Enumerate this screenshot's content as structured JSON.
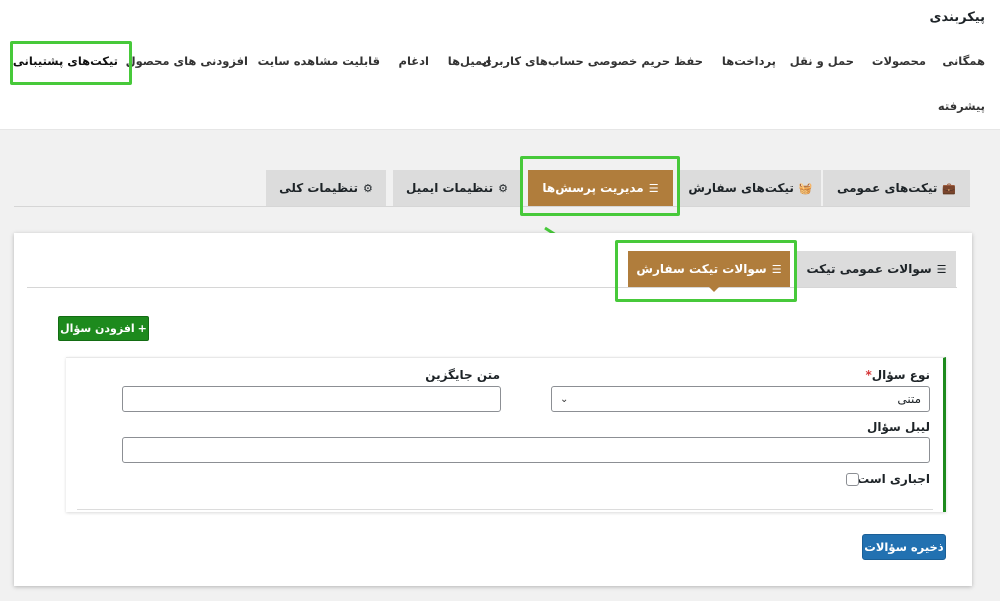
{
  "page": {
    "title": "پیکربندی"
  },
  "nav": {
    "items": [
      "همگانی",
      "محصولات",
      "حمل و نقل",
      "پرداخت‌ها",
      "حفظ حریم خصوصی حساب‌های کاربری",
      "ایمیل‌ها",
      "ادغام",
      "قابلیت مشاهده سایت",
      "افزودنی های محصول",
      "تیکت‌های پشتیبانی",
      "پیشرفته"
    ],
    "active": "تیکت‌های پشتیبانی"
  },
  "tabs": {
    "items": [
      {
        "label": "تیکت‌های عمومی",
        "icon": "briefcase-icon"
      },
      {
        "label": "تیکت‌های سفارش",
        "icon": "basket-icon"
      },
      {
        "label": "مدیریت پرسش‌ها",
        "icon": "list-icon"
      },
      {
        "label": "تنظیمات ایمیل",
        "icon": "gears-icon"
      },
      {
        "label": "تنظیمات کلی",
        "icon": "gears-icon"
      }
    ],
    "active": "مدیریت پرسش‌ها"
  },
  "subtabs": {
    "items": [
      {
        "label": "سوالات عمومی تیکت",
        "icon": "list-icon"
      },
      {
        "label": "سوالات تیکت سفارش",
        "icon": "list-icon"
      }
    ],
    "active": "سوالات تیکت سفارش"
  },
  "buttons": {
    "add_question": "افزودن سؤال",
    "add_icon_glyph": "+",
    "save": "ذخیره سؤالات"
  },
  "form": {
    "question_type_label": "نوع سؤال",
    "required_mark": "*",
    "question_type_value": "متنی",
    "placeholder_label": "متن جایگزین",
    "placeholder_value": "",
    "question_label_label": "لیبل سؤال",
    "question_label_value": "",
    "required_label": "اجباری است؟",
    "required_checked": false
  },
  "colors": {
    "accent_brown": "#b07d3c",
    "green": "#1d8a1d",
    "highlight_green": "#47c93a",
    "primary_blue": "#2271b1"
  }
}
